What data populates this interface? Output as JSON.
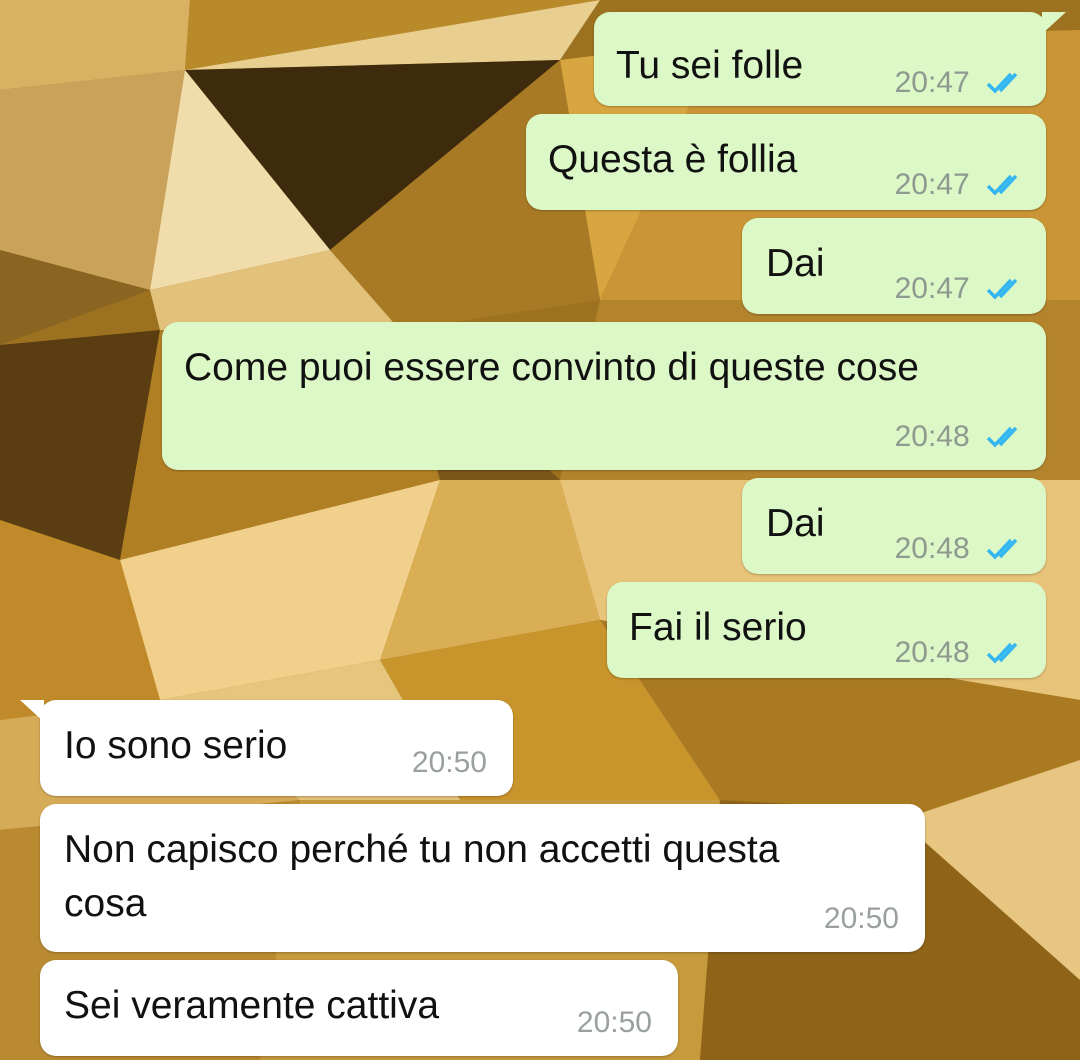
{
  "chat": {
    "messages": [
      {
        "direction": "outgoing",
        "text": "Tu sei folle",
        "time": "20:47",
        "status": "read"
      },
      {
        "direction": "outgoing",
        "text": "Questa è follia",
        "time": "20:47",
        "status": "read"
      },
      {
        "direction": "outgoing",
        "text": "Dai",
        "time": "20:47",
        "status": "read"
      },
      {
        "direction": "outgoing",
        "text": "Come puoi essere convinto di queste cose",
        "time": "20:48",
        "status": "read"
      },
      {
        "direction": "outgoing",
        "text": "Dai",
        "time": "20:48",
        "status": "read"
      },
      {
        "direction": "outgoing",
        "text": "Fai il serio",
        "time": "20:48",
        "status": "read"
      },
      {
        "direction": "incoming",
        "text": "Io sono serio",
        "time": "20:50"
      },
      {
        "direction": "incoming",
        "text_line1": "Non capisco perché tu non accetti questa",
        "text_line2": "cosa",
        "time": "20:50"
      },
      {
        "direction": "incoming",
        "text": "Sei veramente cattiva",
        "time": "20:50"
      }
    ]
  },
  "colors": {
    "outgoing_bubble": "#dcf8c6",
    "incoming_bubble": "#ffffff",
    "read_tick": "#34b7f1",
    "wallpaper_gold": "#c8962e"
  },
  "icons": {
    "read_receipt": "double-check-icon"
  }
}
